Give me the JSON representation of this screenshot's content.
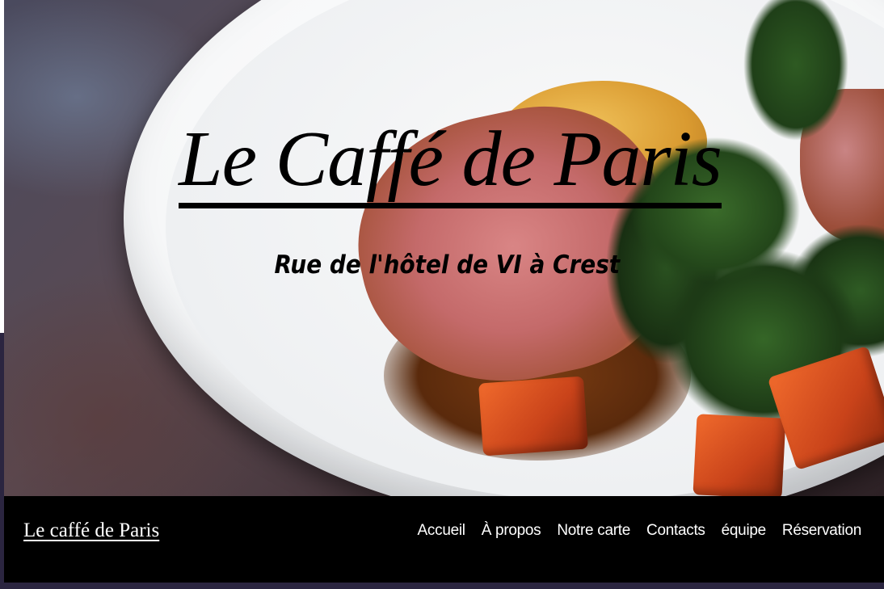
{
  "hero": {
    "title": "Le Caffé de Paris",
    "subtitle": "Rue de l'hôtel de VI à Crest",
    "background_image": "plated-dish-photo"
  },
  "navbar": {
    "brand": "Le caffé de Paris",
    "links": [
      {
        "label": "Accueil"
      },
      {
        "label": "À propos"
      },
      {
        "label": "Notre carte"
      },
      {
        "label": "Contacts"
      },
      {
        "label": "équipe"
      },
      {
        "label": "Réservation"
      }
    ],
    "background_color": "#000000",
    "text_color": "#ffffff"
  }
}
